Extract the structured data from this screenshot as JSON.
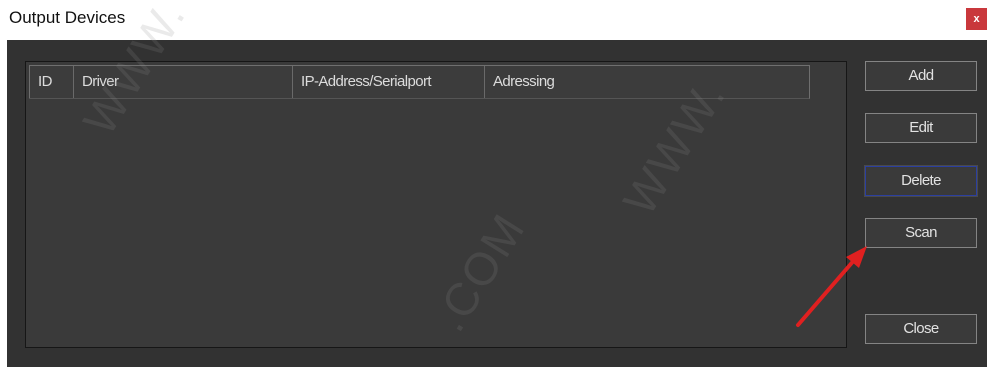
{
  "window": {
    "title": "Output Devices",
    "close_glyph": "x"
  },
  "table": {
    "columns": [
      "ID",
      "Driver",
      "IP-Address/Serialport",
      "Adressing"
    ],
    "rows": []
  },
  "buttons": {
    "add": "Add",
    "edit": "Edit",
    "delete": "Delete",
    "scan": "Scan",
    "close": "Close"
  },
  "watermarks": [
    "WWW.",
    "WWW.",
    ".COM"
  ],
  "colors": {
    "dialog_bg": "#323232",
    "list_bg": "#3a3a3a",
    "title_close_bg": "#c9383c",
    "annotation_arrow": "#e02020",
    "focused_border": "#2b3fa0"
  },
  "icons": {
    "close": "close-icon",
    "annotation": "red-arrow-annotation"
  }
}
